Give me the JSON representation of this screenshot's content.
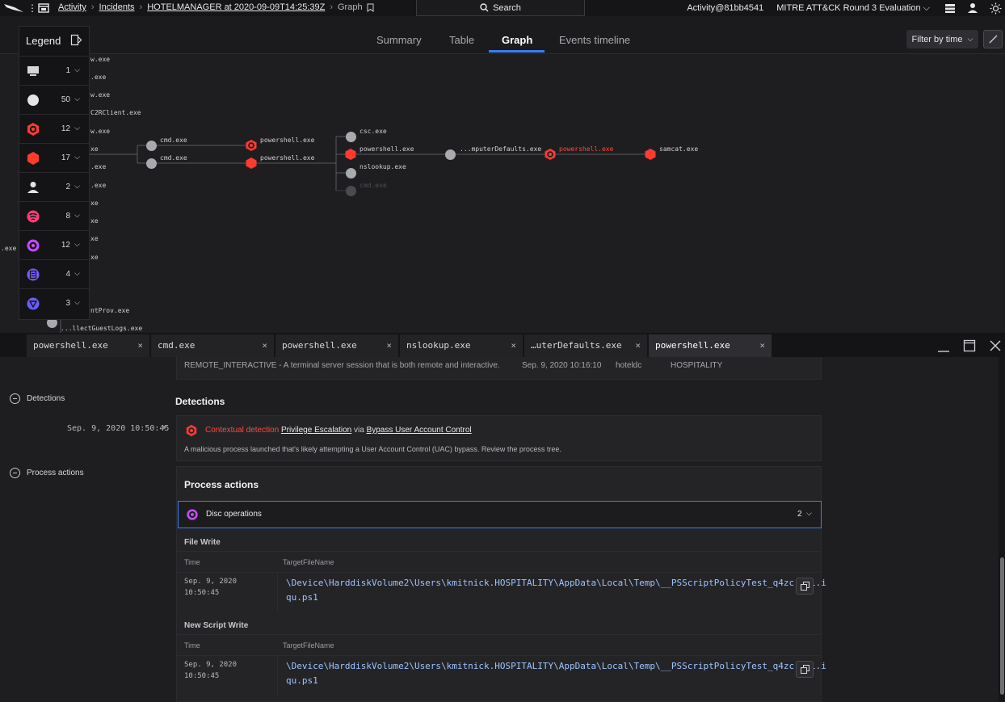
{
  "topbar": {
    "breadcrumbs": [
      "Activity",
      "Incidents",
      "HOTELMANAGER at 2020-09-09T14:25:39Z"
    ],
    "current": "Graph",
    "search_label": "Search",
    "account": "Activity@81bb4541",
    "customer": "MITRE ATT&CK Round 3 Evaluation"
  },
  "view_tabs": [
    "Summary",
    "Table",
    "Graph",
    "Events timeline"
  ],
  "active_tab": "Graph",
  "filter_button": "Filter by time",
  "legend": {
    "title": "Legend",
    "rows": [
      {
        "icon": "computer-icon",
        "count": "1"
      },
      {
        "icon": "process-icon",
        "count": "50"
      },
      {
        "icon": "detection-ring-icon",
        "count": "12",
        "color": "#ff3b30"
      },
      {
        "icon": "detection-hexagon-icon",
        "count": "17",
        "color": "#ff3b30"
      },
      {
        "icon": "user-icon",
        "count": "2"
      },
      {
        "icon": "network-icon",
        "count": "8",
        "color": "#ff3d7a"
      },
      {
        "icon": "disk-icon",
        "count": "12",
        "color": "#c44bff"
      },
      {
        "icon": "registry-icon",
        "count": "4",
        "color": "#7b5cff"
      },
      {
        "icon": "dns-icon",
        "count": "3",
        "color": "#6b5cff"
      }
    ]
  },
  "graph": {
    "left_labels": [
      "w.exe",
      ".exe",
      "w.exe",
      "C2RClient.exe",
      "w.exe",
      "xe",
      ".exe",
      ".exe",
      "xe",
      "xe",
      "xe",
      "xe",
      "ntProv.exe",
      "...llectGuestLogs.exe",
      ".exe"
    ],
    "nodes": [
      {
        "label": "cmd.exe"
      },
      {
        "label": "cmd.exe"
      },
      {
        "label": "powershell.exe"
      },
      {
        "label": "powershell.exe"
      },
      {
        "label": "csc.exe"
      },
      {
        "label": "powershell.exe"
      },
      {
        "label": "nslookup.exe"
      },
      {
        "label": "cmd.exe"
      },
      {
        "label": "...mputerDefaults.exe"
      },
      {
        "label": "powershell.exe"
      },
      {
        "label": "samcat.exe"
      }
    ]
  },
  "process_tabs": [
    {
      "label": "powershell.exe"
    },
    {
      "label": "cmd.exe"
    },
    {
      "label": "powershell.exe"
    },
    {
      "label": "nslookup.exe"
    },
    {
      "label": "…uterDefaults.exe"
    },
    {
      "label": "powershell.exe"
    }
  ],
  "close_glyph": "×",
  "session_row": {
    "text": "REMOTE_INTERACTIVE - A terminal server session that is both remote and interactive.",
    "time": "Sep. 9, 2020 10:16:10",
    "host": "hoteldc",
    "domain": "HOSPITALITY"
  },
  "sections": {
    "detections_label": "Detections",
    "process_actions_label": "Process actions"
  },
  "detection": {
    "timestamp": "Sep. 9, 2020 10:50:45",
    "prefix": "Contextual detection",
    "tactic": "Privilege Escalation",
    "via": "via",
    "technique": "Bypass User Account Control",
    "description": "A malicious process launched that's likely attempting a User Account Control (UAC) bypass. Review the process tree.",
    "accent": "#ff3b30"
  },
  "process_actions": {
    "title": "Process actions",
    "group": {
      "label": "Disc operations",
      "count": "2"
    },
    "blocks": [
      {
        "title": "File Write",
        "col_time": "Time",
        "col_target": "TargetFileName",
        "time_line1": "Sep. 9, 2020",
        "time_line2": "10:50:45",
        "path_line1": "\\Device\\HarddiskVolume2\\Users\\kmitnick.HOSPITALITY\\AppData\\Local\\Temp\\__PSScriptPolicyTest_q4zcrjzi.i",
        "path_line2": "qu.ps1"
      },
      {
        "title": "New Script Write",
        "col_time": "Time",
        "col_target": "TargetFileName",
        "time_line1": "Sep. 9, 2020",
        "time_line2": "10:50:45",
        "path_line1": "\\Device\\HarddiskVolume2\\Users\\kmitnick.HOSPITALITY\\AppData\\Local\\Temp\\__PSScriptPolicyTest_q4zcrjzi.i",
        "path_line2": "qu.ps1"
      }
    ]
  }
}
